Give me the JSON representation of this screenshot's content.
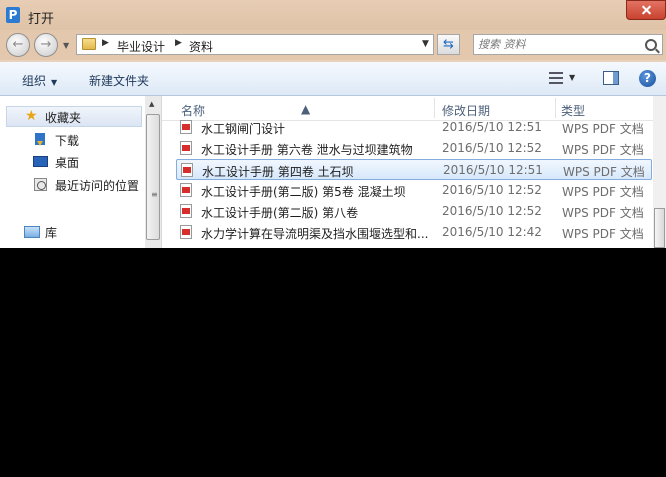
{
  "window": {
    "title": "打开",
    "app_icon": "P"
  },
  "navigation": {
    "back_glyph": "←",
    "forward_glyph": "→"
  },
  "address": {
    "crumbs": [
      "毕业设计",
      "资料"
    ],
    "search_placeholder": "搜索 资料"
  },
  "toolbar": {
    "organize": "组织",
    "new_folder": "新建文件夹",
    "help": "?"
  },
  "sidebar": {
    "favorites": "收藏夹",
    "downloads": "下载",
    "desktop": "桌面",
    "recent": "最近访问的位置",
    "libraries": "库"
  },
  "columns": {
    "name": "名称",
    "modified": "修改日期",
    "type": "类型"
  },
  "files": [
    {
      "name": "水工钢闸门设计",
      "modified": "2016/5/10 12:51",
      "type": "WPS PDF 文档"
    },
    {
      "name": "水工设计手册 第六卷 泄水与过坝建筑物",
      "modified": "2016/5/10 12:52",
      "type": "WPS PDF 文档"
    },
    {
      "name": "水工设计手册 第四卷 土石坝",
      "modified": "2016/5/10 12:51",
      "type": "WPS PDF 文档"
    },
    {
      "name": "水工设计手册(第二版) 第5卷 混凝土坝",
      "modified": "2016/5/10 12:52",
      "type": "WPS PDF 文档"
    },
    {
      "name": "水工设计手册(第二版) 第八卷",
      "modified": "2016/5/10 12:52",
      "type": "WPS PDF 文档"
    },
    {
      "name": "水力学计算在导流明渠及挡水围堰选型和...",
      "modified": "2016/5/10 12:42",
      "type": "WPS PDF 文档"
    }
  ],
  "selected_index": 2
}
